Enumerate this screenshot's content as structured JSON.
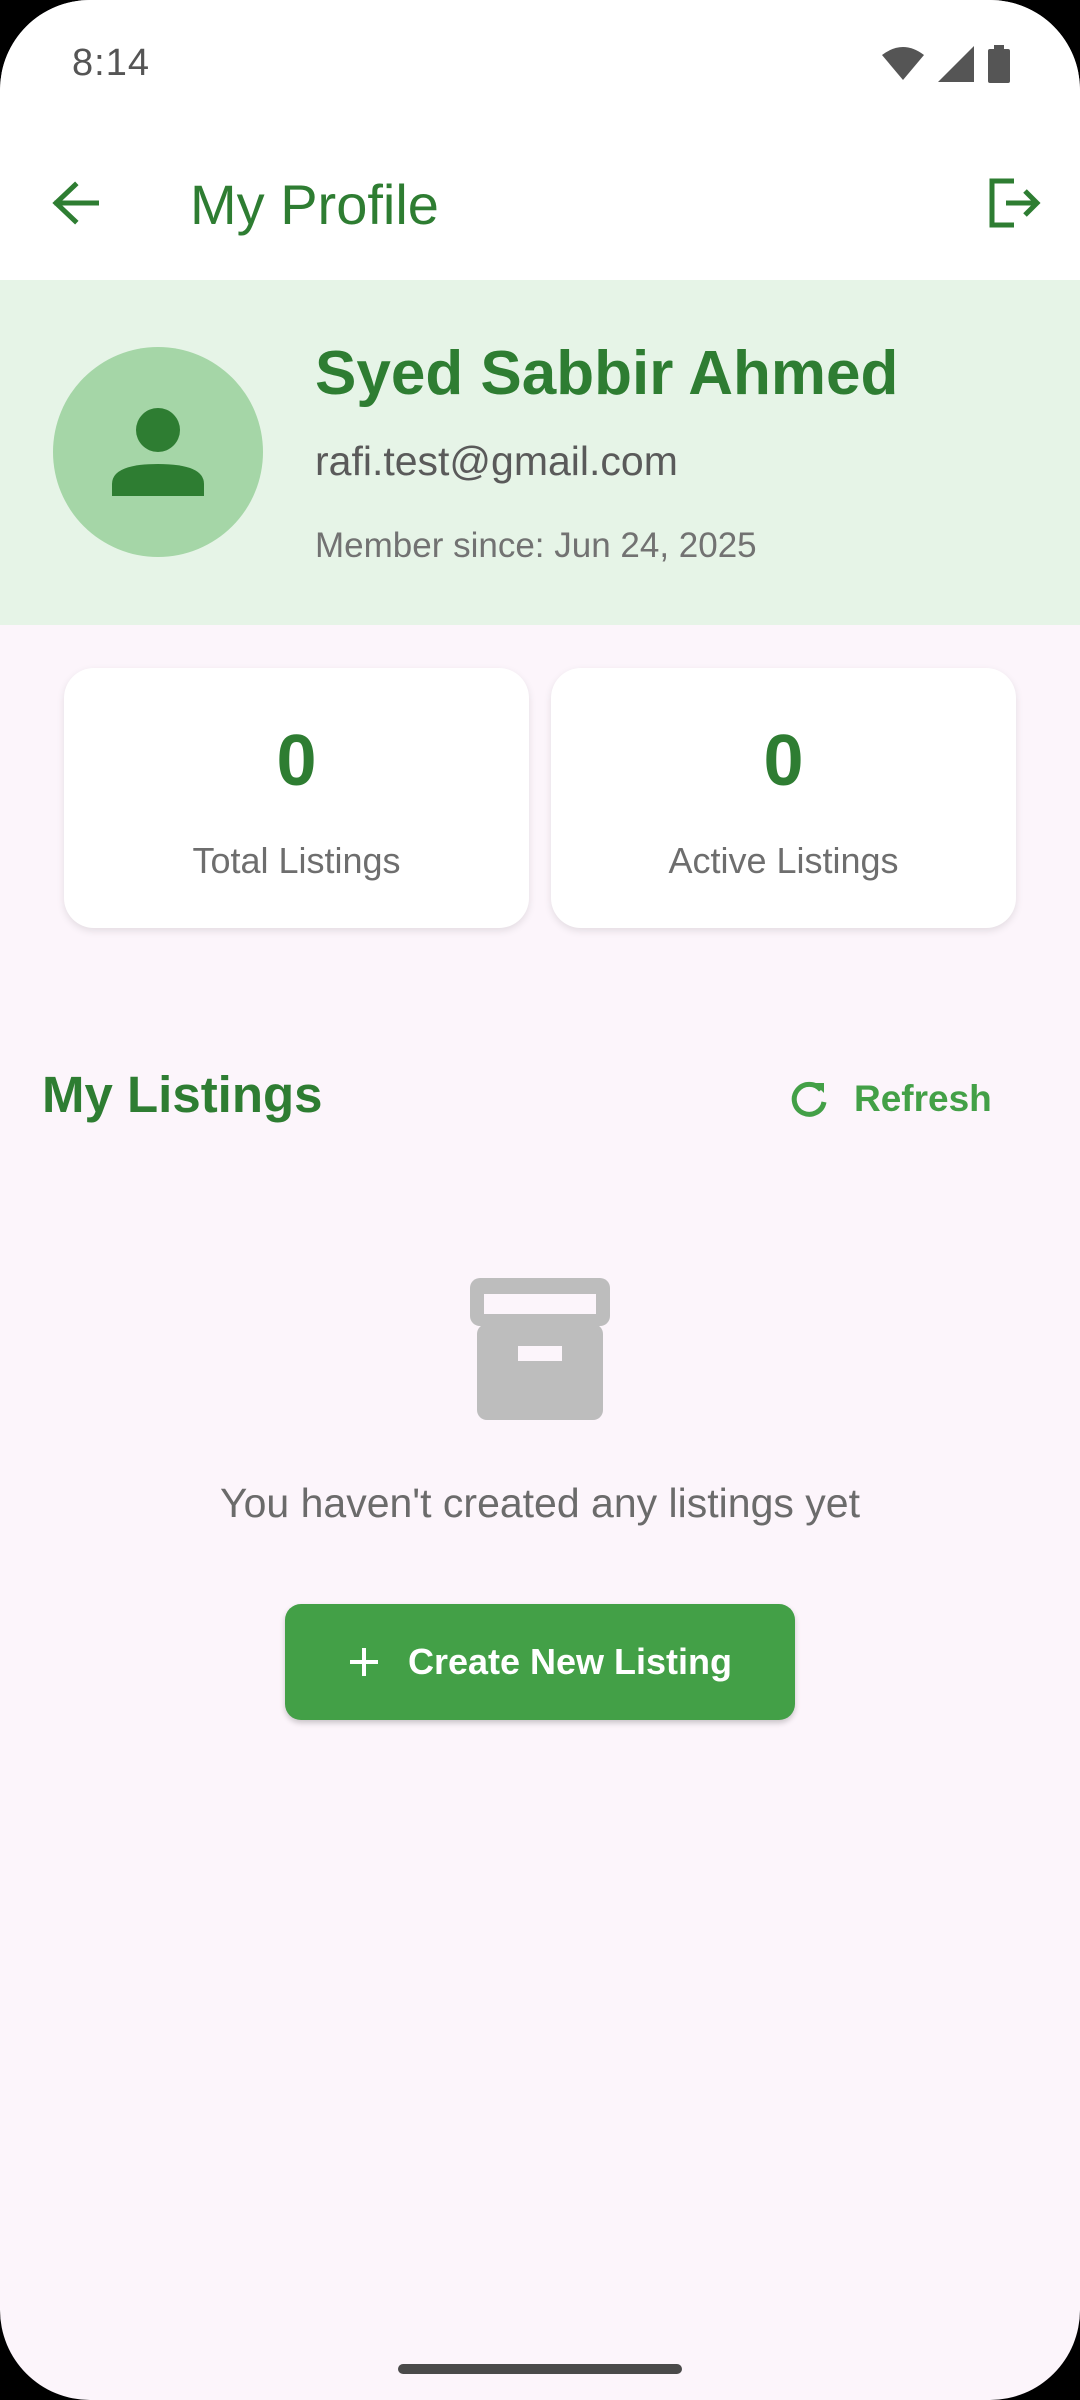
{
  "status_bar": {
    "time": "8:14",
    "icons": [
      "wifi-icon",
      "signal-icon",
      "battery-icon"
    ]
  },
  "app_bar": {
    "title": "My Profile",
    "back_icon": "arrow-left-icon",
    "logout_icon": "logout-icon"
  },
  "profile": {
    "name": "Syed Sabbir Ahmed",
    "email": "rafi.test@gmail.com",
    "member_since": "Member since: Jun 24, 2025",
    "avatar_icon": "person-icon"
  },
  "stats": {
    "total": {
      "value": "0",
      "label": "Total Listings"
    },
    "active": {
      "value": "0",
      "label": "Active Listings"
    }
  },
  "listings": {
    "title": "My Listings",
    "refresh_label": "Refresh",
    "empty_icon": "archive-icon",
    "empty_text": "You haven't created any listings yet",
    "create_label": "Create New Listing"
  },
  "colors": {
    "primary": "#2e7d32",
    "button": "#43a047",
    "header_bg": "#e6f4e7",
    "avatar_bg": "#a5d6a7",
    "page_bg": "#fcf5fb"
  }
}
